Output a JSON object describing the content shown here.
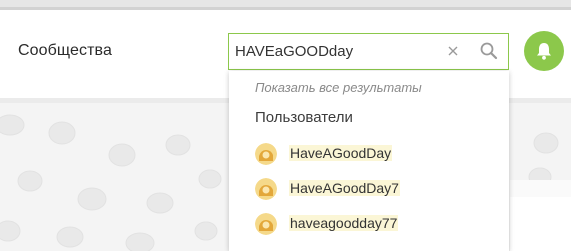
{
  "header": {
    "title": "Сообщества"
  },
  "search": {
    "value": "HAVEaGOODday",
    "clear_icon": "close-icon",
    "search_icon": "search-icon"
  },
  "notifications": {
    "icon": "bell-icon",
    "accent_color": "#8cc84b"
  },
  "dropdown": {
    "show_all_label": "Показать все результаты",
    "section_title": "Пользователи",
    "users": [
      {
        "name": "HaveAGoodDay"
      },
      {
        "name": "HaveAGoodDay7"
      },
      {
        "name": "haveagoodday77"
      }
    ]
  }
}
